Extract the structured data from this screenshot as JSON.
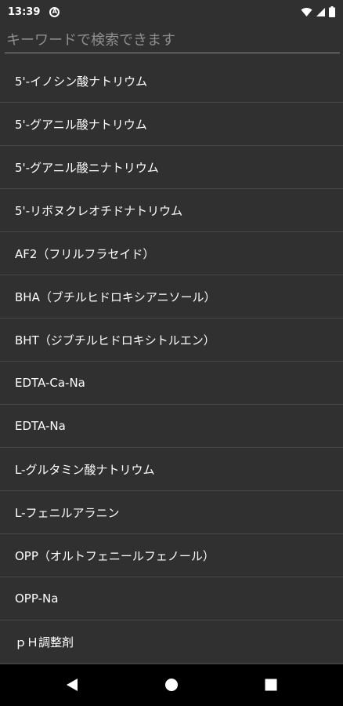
{
  "status_bar": {
    "time": "13:39",
    "badge": "A"
  },
  "search": {
    "placeholder": "キーワードで検索できます",
    "value": ""
  },
  "items": [
    "5'-イノシン酸ナトリウム",
    "5'-グアニル酸ナトリウム",
    "5'-グアニル酸ニナトリウム",
    "5'-リボヌクレオチドナトリウム",
    "AF2（フリルフラセイド）",
    "BHA（ブチルヒドロキシアニソール）",
    "BHT（ジブチルヒドロキシトルエン）",
    "EDTA-Ca-Na",
    "EDTA-Na",
    "L-グルタミン酸ナトリウム",
    "L-フェニルアラニン",
    "OPP（オルトフェニールフェノール）",
    "OPP-Na",
    "ｐＨ調整剤"
  ],
  "icons": {
    "wifi": "wifi-icon",
    "signal": "signal-icon",
    "battery": "battery-icon",
    "back": "back-icon",
    "home": "home-icon",
    "recents": "recents-icon"
  }
}
